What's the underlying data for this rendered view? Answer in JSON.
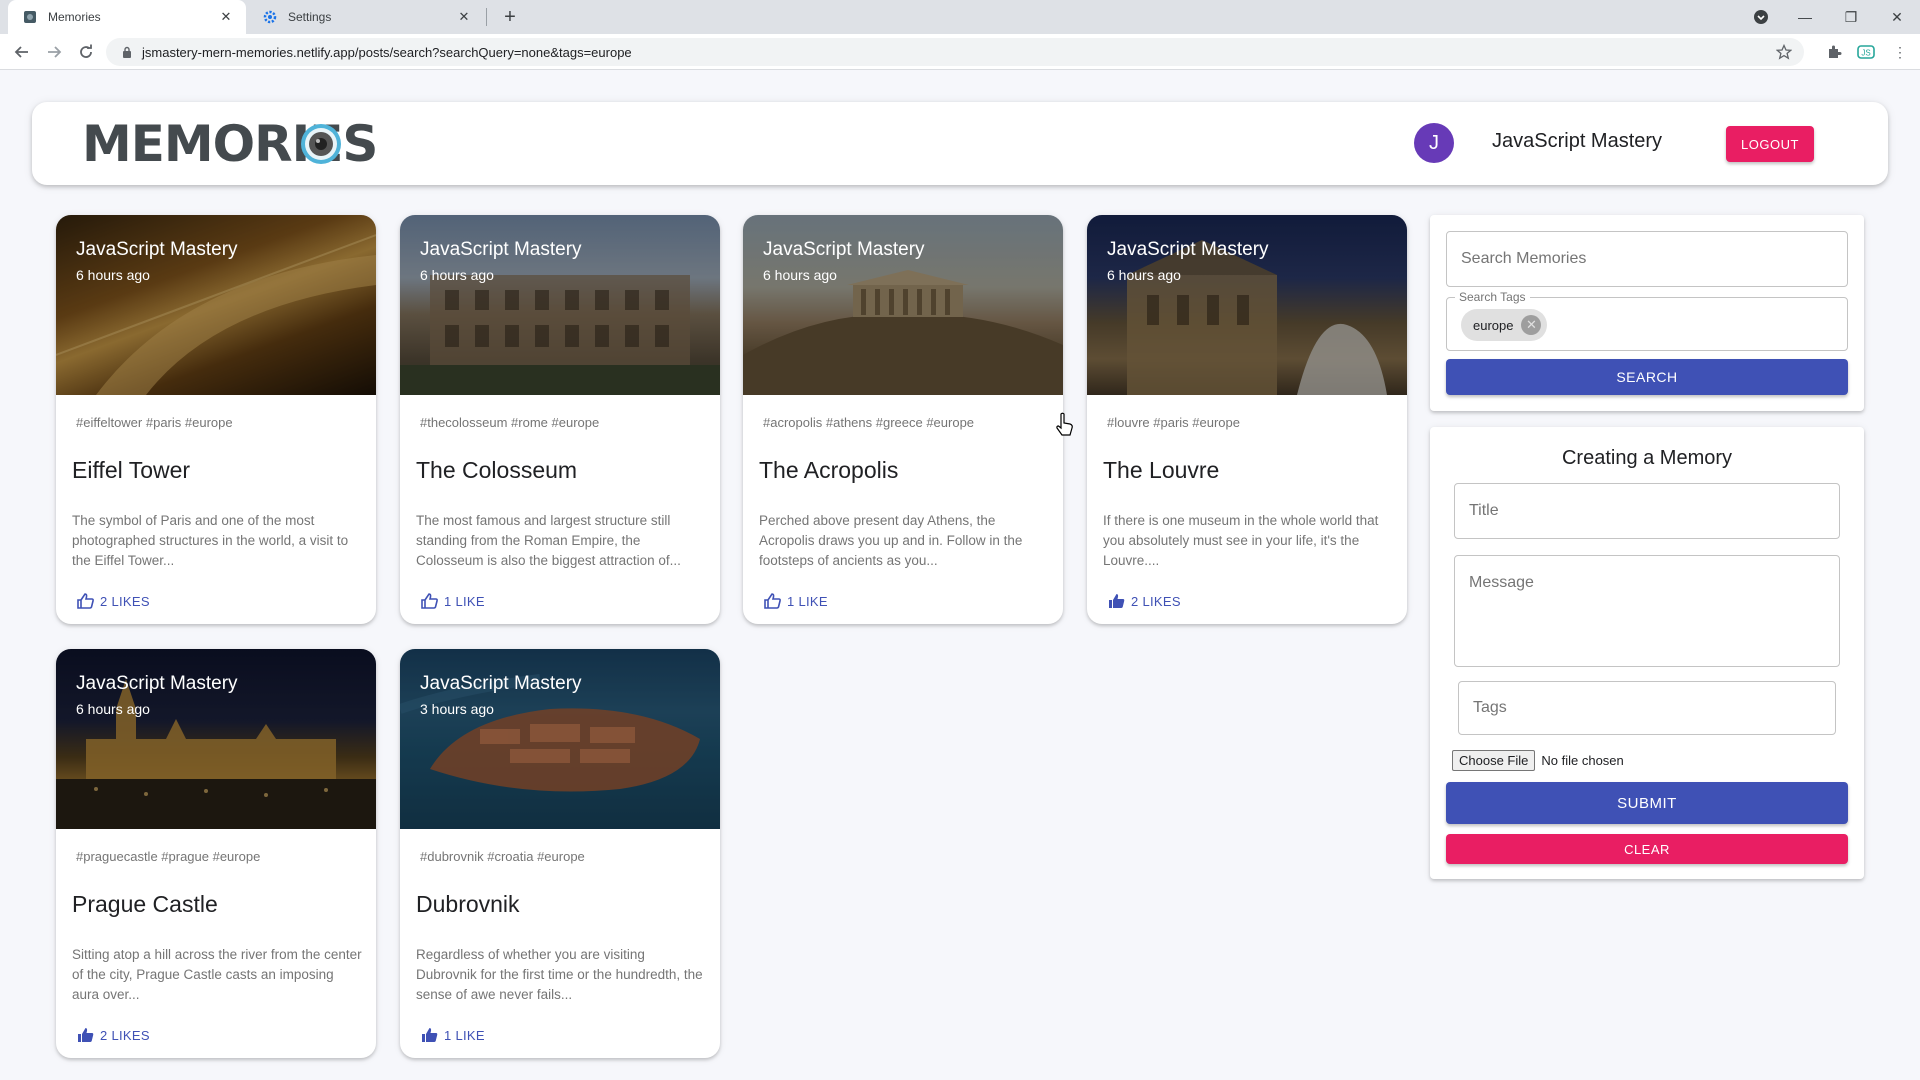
{
  "browser": {
    "tabs": [
      {
        "title": "Memories",
        "active": true
      },
      {
        "title": "Settings",
        "active": false
      }
    ],
    "url": "jsmastery-mern-memories.netlify.app/posts/search?searchQuery=none&tags=europe"
  },
  "header": {
    "logo_text": "MEMORIES",
    "avatar_initial": "J",
    "user_name": "JavaScript Mastery",
    "logout_label": "LOGOUT"
  },
  "posts": [
    {
      "author": "JavaScript Mastery",
      "time": "6 hours ago",
      "tags": "#eiffeltower #paris #europe",
      "title": "Eiffel Tower",
      "message": "The symbol of Paris and one of the most photographed structures in the world, a visit to the Eiffel Tower...",
      "likes": "2 LIKES"
    },
    {
      "author": "JavaScript Mastery",
      "time": "6 hours ago",
      "tags": "#thecolosseum #rome #europe",
      "title": "The Colosseum",
      "message": "The most famous and largest structure still standing from the Roman Empire, the Colosseum is also the biggest attraction of...",
      "likes": "1 LIKE"
    },
    {
      "author": "JavaScript Mastery",
      "time": "6 hours ago",
      "tags": "#acropolis #athens #greece #europe",
      "title": "The Acropolis",
      "message": "Perched above present day Athens, the Acropolis draws you up and in. Follow in the footsteps of ancients as you...",
      "likes": "1 LIKE"
    },
    {
      "author": "JavaScript Mastery",
      "time": "6 hours ago",
      "tags": "#louvre #paris #europe",
      "title": "The Louvre",
      "message": "If there is one museum in the whole world that you absolutely must see in your life, it's the Louvre....",
      "likes": "2 LIKES"
    },
    {
      "author": "JavaScript Mastery",
      "time": "6 hours ago",
      "tags": "#praguecastle #prague #europe",
      "title": "Prague Castle",
      "message": "Sitting atop a hill across the river from the center of the city, Prague Castle casts an imposing aura over...",
      "likes": "2 LIKES"
    },
    {
      "author": "JavaScript Mastery",
      "time": "3 hours ago",
      "tags": "#dubrovnik #croatia #europe",
      "title": "Dubrovnik",
      "message": "Regardless of whether you are visiting Dubrovnik for the first time or the hundredth, the sense of awe never fails...",
      "likes": "1 LIKE"
    }
  ],
  "search": {
    "memories_placeholder": "Search Memories",
    "tags_label": "Search Tags",
    "tag_chip": "europe",
    "button_label": "SEARCH"
  },
  "form": {
    "title": "Creating a Memory",
    "title_placeholder": "Title",
    "message_placeholder": "Message",
    "tags_placeholder": "Tags",
    "file_button": "Choose File",
    "file_status": "No file chosen",
    "submit_label": "SUBMIT",
    "clear_label": "CLEAR"
  },
  "colors": {
    "primary": "#3f51b5",
    "secondary": "#e91e63",
    "avatar": "#673ab7"
  }
}
